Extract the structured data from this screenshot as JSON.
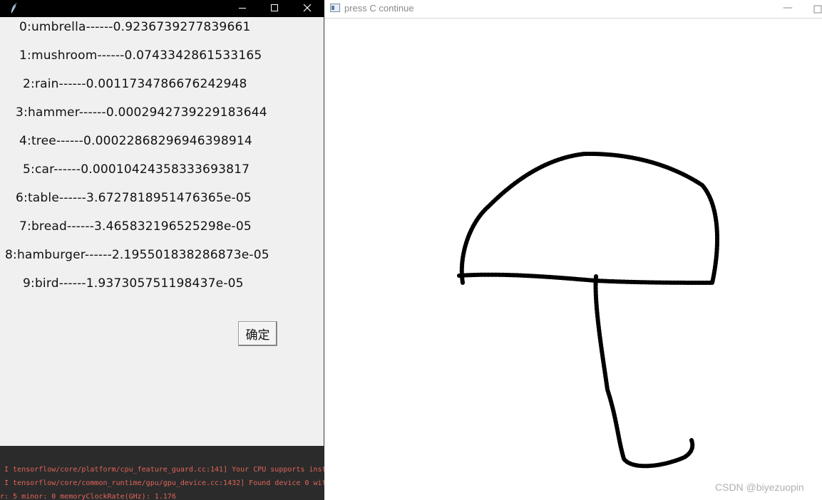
{
  "canvas_window": {
    "title": "press C continue",
    "min_glyph": "—",
    "watermark": "CSDN @biyezuopin"
  },
  "result_window": {
    "results": [
      {
        "label": "0:umbrella------0.9236739277839661"
      },
      {
        "label": "1:mushroom------0.0743342861533165"
      },
      {
        "label": "2:rain------0.0011734786676242948"
      },
      {
        "label": "3:hammer------0.0002942739229183644"
      },
      {
        "label": "4:tree------0.00022868296946398914"
      },
      {
        "label": "5:car------0.00010424358333693817"
      },
      {
        "label": "6:table------3.6727818951476365e-05"
      },
      {
        "label": "7:bread------3.465832196525298e-05"
      },
      {
        "label": "8:hamburger------2.195501838286873e-05"
      },
      {
        "label": "9:bird------1.937305751198437e-05"
      }
    ],
    "confirm_label": "确定"
  },
  "console": {
    "lines": [
      "I tensorflow/core/platform/cpu_feature_guard.cc:141] Your CPU supports inst",
      "I tensorflow/core/common_runtime/gpu/gpu_device.cc:1432] Found device 0 wit",
      "r: 5 minor: 0 memoryClockRate(GHz): 1.176"
    ]
  },
  "colors": {
    "titlebar": "#000000",
    "window_bg": "#f0f0f0",
    "console_bg": "#2b2b2b",
    "console_text": "#e0645a",
    "stroke": "#000000"
  }
}
